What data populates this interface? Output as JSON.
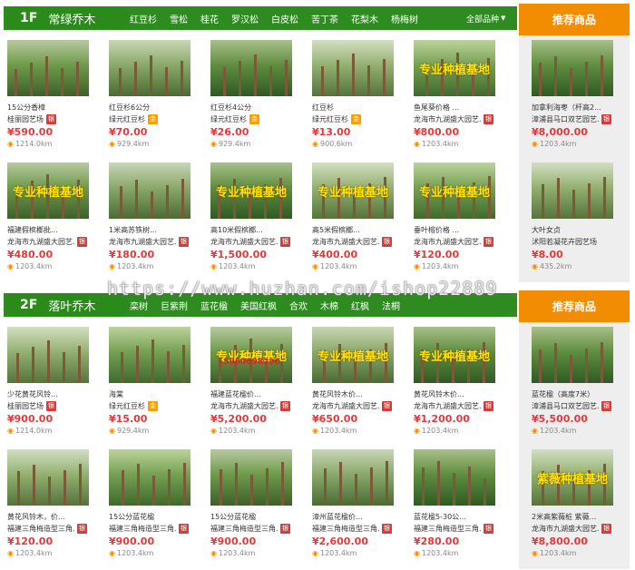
{
  "colors": {
    "floor_green": "#2e8b1f",
    "recommend_orange": "#f28c00",
    "price_red": "#e4393c"
  },
  "floors": [
    {
      "num": "1F",
      "name": "常绿乔木",
      "tabs": [
        "红豆杉",
        "雪松",
        "桂花",
        "罗汉松",
        "白皮松",
        "苦丁茶",
        "花梨木",
        "杨梅树"
      ],
      "more": "全部品种",
      "recommend_title": "推荐商品",
      "products": [
        {
          "title": "15公分香樟",
          "shop": "桂丽园艺场",
          "badge": "银",
          "price": "¥590.00",
          "distance": "1214.0km",
          "overlay": ""
        },
        {
          "title": "红豆杉6公分",
          "shop": "绿元红豆杉",
          "badge": "金",
          "price": "¥70.00",
          "distance": "929.4km",
          "overlay": ""
        },
        {
          "title": "红豆杉4公分",
          "shop": "绿元红豆杉",
          "badge": "金",
          "price": "¥26.00",
          "distance": "929.4km",
          "overlay": ""
        },
        {
          "title": "红豆杉",
          "shop": "绿元红豆杉",
          "badge": "金",
          "price": "¥13.00",
          "distance": "900.6km",
          "overlay": ""
        },
        {
          "title": "鱼尾葵价格 ...",
          "shop": "龙海市九湖盛大园艺...",
          "badge": "银",
          "price": "¥800.00",
          "distance": "1203.4km",
          "overlay": "专业种植基地"
        },
        {
          "title": "福建假槟榔批...",
          "shop": "龙海市九湖盛大园艺...",
          "badge": "银",
          "price": "¥480.00",
          "distance": "1203.4km",
          "overlay": "专业种植基地"
        },
        {
          "title": "1米高苏铁树...",
          "shop": "龙海市九湖盛大园艺...",
          "badge": "银",
          "price": "¥180.00",
          "distance": "1203.4km",
          "overlay": ""
        },
        {
          "title": "高10米假槟榔...",
          "shop": "龙海市九湖盛大园艺...",
          "badge": "银",
          "price": "¥1,500.00",
          "distance": "1203.4km",
          "overlay": "专业种植基地"
        },
        {
          "title": "高5米假槟榔...",
          "shop": "龙海市九湖盛大园艺...",
          "badge": "银",
          "price": "¥400.00",
          "distance": "1203.4km",
          "overlay": "专业种植基地"
        },
        {
          "title": "垂叶榕价格 ...",
          "shop": "龙海市九湖盛大园艺...",
          "badge": "银",
          "price": "¥120.00",
          "distance": "1203.4km",
          "overlay": "专业种植基地"
        }
      ],
      "recommended": [
        {
          "title": "加拿利海枣（杆高2...",
          "shop": "漳浦县马口双艺园艺...",
          "badge": "银",
          "price": "¥8,000.00",
          "distance": "1203.4km"
        },
        {
          "title": "大叶女贞",
          "shop": "沭阳若凝花卉园艺场",
          "badge": "",
          "price": "¥8.00",
          "distance": "435.2km"
        }
      ]
    },
    {
      "num": "2F",
      "name": "落叶乔木",
      "tabs": [
        "栾树",
        "巨紫荆",
        "蓝花楹",
        "美国红枫",
        "合欢",
        "木棉",
        "红枫",
        "法桐"
      ],
      "more": "",
      "recommend_title": "推荐商品",
      "products": [
        {
          "title": "少花黄花风铃...",
          "shop": "桂丽园艺场",
          "badge": "银",
          "price": "¥900.00",
          "distance": "1214.0km",
          "overlay": ""
        },
        {
          "title": "海棠",
          "shop": "绿元红豆杉",
          "badge": "金",
          "price": "¥15.00",
          "distance": "929.4km",
          "overlay": ""
        },
        {
          "title": "福建蓝花楹价...",
          "shop": "龙海市九湖盛大园艺...",
          "badge": "银",
          "price": "¥5,200.00",
          "distance": "1203.4km",
          "overlay": "专业种植基地",
          "phone": "15960698296"
        },
        {
          "title": "黄花风铃木价...",
          "shop": "龙海市九湖盛大园艺...",
          "badge": "银",
          "price": "¥650.00",
          "distance": "1203.4km",
          "overlay": "专业种植基地"
        },
        {
          "title": "黄花风铃木价...",
          "shop": "龙海市九湖盛大园艺...",
          "badge": "银",
          "price": "¥1,200.00",
          "distance": "1203.4km",
          "overlay": "专业种植基地"
        },
        {
          "title": "黄花风铃木，价...",
          "shop": "福建三角梅造型三角...",
          "badge": "银",
          "price": "¥120.00",
          "distance": "1203.4km",
          "overlay": ""
        },
        {
          "title": "15公分蓝花楹",
          "shop": "福建三角梅造型三角...",
          "badge": "银",
          "price": "¥900.00",
          "distance": "1203.4km",
          "overlay": ""
        },
        {
          "title": "15公分蓝花楹",
          "shop": "福建三角梅造型三角...",
          "badge": "银",
          "price": "¥900.00",
          "distance": "1203.4km",
          "overlay": ""
        },
        {
          "title": "漳州蓝花楹价...",
          "shop": "福建三角梅造型三角...",
          "badge": "银",
          "price": "¥2,600.00",
          "distance": "1203.4km",
          "overlay": ""
        },
        {
          "title": "蓝花楹5-30公...",
          "shop": "福建三角梅造型三角...",
          "badge": "银",
          "price": "¥280.00",
          "distance": "1203.4km",
          "overlay": ""
        }
      ],
      "recommended": [
        {
          "title": "蓝花楹（高度7米）",
          "shop": "漳浦县马口双艺园艺...",
          "badge": "银",
          "price": "¥5,500.00",
          "distance": "1203.4km",
          "overlay": ""
        },
        {
          "title": "2米高紫薇桩 紫薇...",
          "shop": "龙海市九湖盛大园艺...",
          "badge": "银",
          "price": "¥8,800.00",
          "distance": "1203.4km",
          "overlay": "紫薇种植基地"
        }
      ]
    }
  ],
  "watermark": "https://www.huzhan.com/ishop22889"
}
